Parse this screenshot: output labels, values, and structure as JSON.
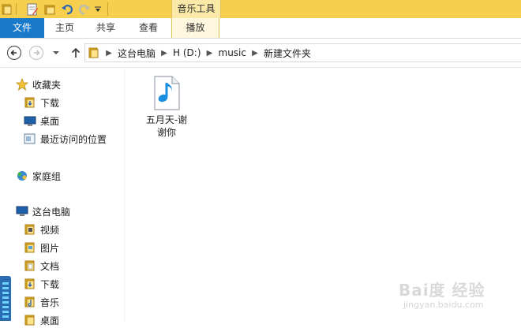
{
  "titlebar": {
    "context_tab_title": "音乐工具",
    "quick_access": [
      "folder-icon",
      "properties-icon",
      "new-folder-icon",
      "undo-icon",
      "redo-icon",
      "chevron-down-icon"
    ]
  },
  "ribbon": {
    "tabs": [
      {
        "label": "文件"
      },
      {
        "label": "主页"
      },
      {
        "label": "共享"
      },
      {
        "label": "查看"
      },
      {
        "label": "播放"
      }
    ]
  },
  "address_bar": {
    "crumbs": [
      "这台电脑",
      "H (D:)",
      "music",
      "新建文件夹"
    ]
  },
  "nav_pane": {
    "favorites": {
      "label": "收藏夹",
      "items": [
        {
          "label": "下载"
        },
        {
          "label": "桌面"
        },
        {
          "label": "最近访问的位置"
        }
      ]
    },
    "homegroup": {
      "label": "家庭组"
    },
    "this_pc": {
      "label": "这台电脑",
      "items": [
        {
          "label": "视频"
        },
        {
          "label": "图片"
        },
        {
          "label": "文档"
        },
        {
          "label": "下载"
        },
        {
          "label": "音乐"
        },
        {
          "label": "桌面"
        }
      ]
    }
  },
  "content": {
    "files": [
      {
        "name": "五月天-谢谢你",
        "icon": "music-file-icon"
      }
    ]
  },
  "watermark": {
    "main": "Bai度 经验",
    "sub": "jingyan.baidu.com"
  },
  "colors": {
    "titlebar": "#f6cf4f",
    "file_tab": "#1979ca",
    "gauge": "#2a6db3"
  }
}
